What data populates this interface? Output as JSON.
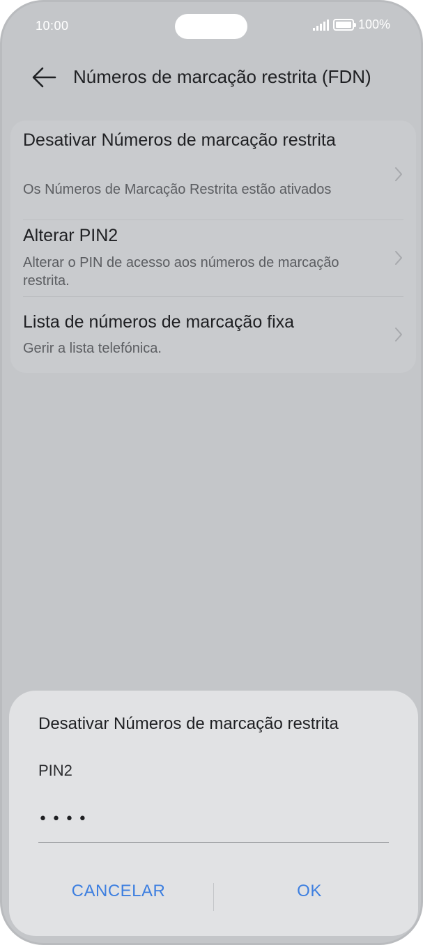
{
  "status_bar": {
    "time": "10:00",
    "battery": "100%",
    "signal_icon": "signal-icon",
    "battery_icon": "battery-icon"
  },
  "header": {
    "title": "Números de marcação restrita (FDN)",
    "back_icon": "back-arrow-icon"
  },
  "settings": {
    "items": [
      {
        "title": "Desativar Números de marcação restrita",
        "subtitle": "Os Números de Marcação Restrita estão ativados"
      },
      {
        "title": "Alterar PIN2",
        "subtitle": "Alterar o PIN de acesso aos números de marcação restrita."
      },
      {
        "title": "Lista de números de marcação fixa",
        "subtitle": "Gerir a lista telefónica."
      }
    ]
  },
  "dialog": {
    "title": "Desativar Números de marcação restrita",
    "field_label": "PIN2",
    "field_value": "••••",
    "cancel_label": "CANCELAR",
    "ok_label": "OK"
  },
  "colors": {
    "accent": "#3d7fe0",
    "overlay_background": "#c4c6c9",
    "dialog_background": "#e1e2e4"
  }
}
